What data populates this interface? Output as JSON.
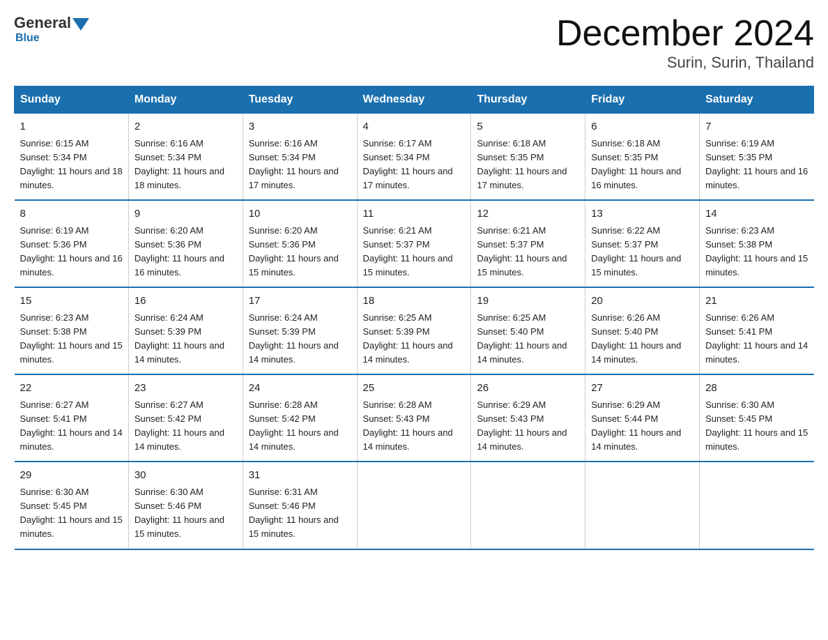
{
  "logo": {
    "general": "General",
    "blue": "Blue"
  },
  "title": "December 2024",
  "subtitle": "Surin, Surin, Thailand",
  "days": [
    "Sunday",
    "Monday",
    "Tuesday",
    "Wednesday",
    "Thursday",
    "Friday",
    "Saturday"
  ],
  "weeks": [
    [
      {
        "day": "1",
        "sunrise": "6:15 AM",
        "sunset": "5:34 PM",
        "daylight": "11 hours and 18 minutes."
      },
      {
        "day": "2",
        "sunrise": "6:16 AM",
        "sunset": "5:34 PM",
        "daylight": "11 hours and 18 minutes."
      },
      {
        "day": "3",
        "sunrise": "6:16 AM",
        "sunset": "5:34 PM",
        "daylight": "11 hours and 17 minutes."
      },
      {
        "day": "4",
        "sunrise": "6:17 AM",
        "sunset": "5:34 PM",
        "daylight": "11 hours and 17 minutes."
      },
      {
        "day": "5",
        "sunrise": "6:18 AM",
        "sunset": "5:35 PM",
        "daylight": "11 hours and 17 minutes."
      },
      {
        "day": "6",
        "sunrise": "6:18 AM",
        "sunset": "5:35 PM",
        "daylight": "11 hours and 16 minutes."
      },
      {
        "day": "7",
        "sunrise": "6:19 AM",
        "sunset": "5:35 PM",
        "daylight": "11 hours and 16 minutes."
      }
    ],
    [
      {
        "day": "8",
        "sunrise": "6:19 AM",
        "sunset": "5:36 PM",
        "daylight": "11 hours and 16 minutes."
      },
      {
        "day": "9",
        "sunrise": "6:20 AM",
        "sunset": "5:36 PM",
        "daylight": "11 hours and 16 minutes."
      },
      {
        "day": "10",
        "sunrise": "6:20 AM",
        "sunset": "5:36 PM",
        "daylight": "11 hours and 15 minutes."
      },
      {
        "day": "11",
        "sunrise": "6:21 AM",
        "sunset": "5:37 PM",
        "daylight": "11 hours and 15 minutes."
      },
      {
        "day": "12",
        "sunrise": "6:21 AM",
        "sunset": "5:37 PM",
        "daylight": "11 hours and 15 minutes."
      },
      {
        "day": "13",
        "sunrise": "6:22 AM",
        "sunset": "5:37 PM",
        "daylight": "11 hours and 15 minutes."
      },
      {
        "day": "14",
        "sunrise": "6:23 AM",
        "sunset": "5:38 PM",
        "daylight": "11 hours and 15 minutes."
      }
    ],
    [
      {
        "day": "15",
        "sunrise": "6:23 AM",
        "sunset": "5:38 PM",
        "daylight": "11 hours and 15 minutes."
      },
      {
        "day": "16",
        "sunrise": "6:24 AM",
        "sunset": "5:39 PM",
        "daylight": "11 hours and 14 minutes."
      },
      {
        "day": "17",
        "sunrise": "6:24 AM",
        "sunset": "5:39 PM",
        "daylight": "11 hours and 14 minutes."
      },
      {
        "day": "18",
        "sunrise": "6:25 AM",
        "sunset": "5:39 PM",
        "daylight": "11 hours and 14 minutes."
      },
      {
        "day": "19",
        "sunrise": "6:25 AM",
        "sunset": "5:40 PM",
        "daylight": "11 hours and 14 minutes."
      },
      {
        "day": "20",
        "sunrise": "6:26 AM",
        "sunset": "5:40 PM",
        "daylight": "11 hours and 14 minutes."
      },
      {
        "day": "21",
        "sunrise": "6:26 AM",
        "sunset": "5:41 PM",
        "daylight": "11 hours and 14 minutes."
      }
    ],
    [
      {
        "day": "22",
        "sunrise": "6:27 AM",
        "sunset": "5:41 PM",
        "daylight": "11 hours and 14 minutes."
      },
      {
        "day": "23",
        "sunrise": "6:27 AM",
        "sunset": "5:42 PM",
        "daylight": "11 hours and 14 minutes."
      },
      {
        "day": "24",
        "sunrise": "6:28 AM",
        "sunset": "5:42 PM",
        "daylight": "11 hours and 14 minutes."
      },
      {
        "day": "25",
        "sunrise": "6:28 AM",
        "sunset": "5:43 PM",
        "daylight": "11 hours and 14 minutes."
      },
      {
        "day": "26",
        "sunrise": "6:29 AM",
        "sunset": "5:43 PM",
        "daylight": "11 hours and 14 minutes."
      },
      {
        "day": "27",
        "sunrise": "6:29 AM",
        "sunset": "5:44 PM",
        "daylight": "11 hours and 14 minutes."
      },
      {
        "day": "28",
        "sunrise": "6:30 AM",
        "sunset": "5:45 PM",
        "daylight": "11 hours and 15 minutes."
      }
    ],
    [
      {
        "day": "29",
        "sunrise": "6:30 AM",
        "sunset": "5:45 PM",
        "daylight": "11 hours and 15 minutes."
      },
      {
        "day": "30",
        "sunrise": "6:30 AM",
        "sunset": "5:46 PM",
        "daylight": "11 hours and 15 minutes."
      },
      {
        "day": "31",
        "sunrise": "6:31 AM",
        "sunset": "5:46 PM",
        "daylight": "11 hours and 15 minutes."
      },
      null,
      null,
      null,
      null
    ]
  ]
}
